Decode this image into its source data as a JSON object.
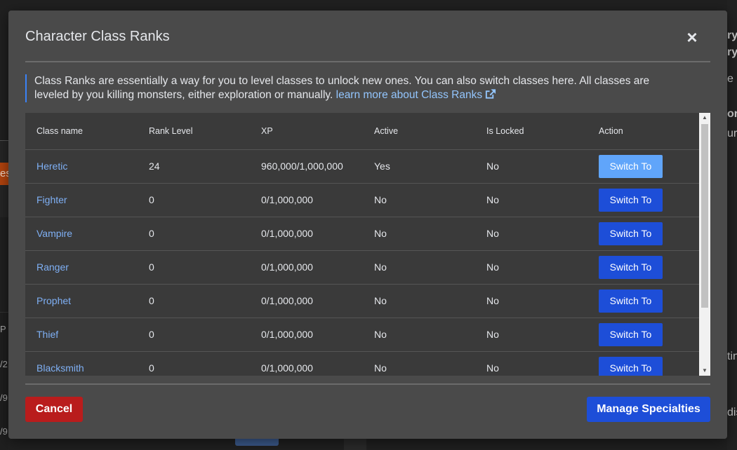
{
  "background": {
    "left_fragments": [
      "es",
      "P",
      "/2",
      "/9",
      "/9"
    ],
    "right_fragments": [
      "ry",
      "ry",
      "e S",
      "or",
      "ure",
      "tin",
      "dis"
    ]
  },
  "modal": {
    "title": "Character Class Ranks",
    "close_symbol": "×",
    "info_text": "Class Ranks are essentially a way for you to level classes to unlock new ones. You can also switch classes here. All classes are leveled by you killing monsters, either exploration or manually.",
    "info_link": "learn more about Class Ranks",
    "table": {
      "headers": [
        "Class name",
        "Rank Level",
        "XP",
        "Active",
        "Is Locked",
        "Action"
      ],
      "rows": [
        {
          "name": "Heretic",
          "rank": "24",
          "xp": "960,000/1,000,000",
          "active": "Yes",
          "locked": "No",
          "action": "Switch To"
        },
        {
          "name": "Fighter",
          "rank": "0",
          "xp": "0/1,000,000",
          "active": "No",
          "locked": "No",
          "action": "Switch To"
        },
        {
          "name": "Vampire",
          "rank": "0",
          "xp": "0/1,000,000",
          "active": "No",
          "locked": "No",
          "action": "Switch To"
        },
        {
          "name": "Ranger",
          "rank": "0",
          "xp": "0/1,000,000",
          "active": "No",
          "locked": "No",
          "action": "Switch To"
        },
        {
          "name": "Prophet",
          "rank": "0",
          "xp": "0/1,000,000",
          "active": "No",
          "locked": "No",
          "action": "Switch To"
        },
        {
          "name": "Thief",
          "rank": "0",
          "xp": "0/1,000,000",
          "active": "No",
          "locked": "No",
          "action": "Switch To"
        },
        {
          "name": "Blacksmith",
          "rank": "0",
          "xp": "0/1,000,000",
          "active": "No",
          "locked": "No",
          "action": "Switch To"
        }
      ]
    },
    "cancel_label": "Cancel",
    "manage_label": "Manage Specialties"
  },
  "colors": {
    "modal_bg": "#4a4a4a",
    "link": "#7fb0f5",
    "primary_button": "#1d4ed8",
    "active_button": "#60a5fa",
    "danger_button": "#b91c1c"
  }
}
